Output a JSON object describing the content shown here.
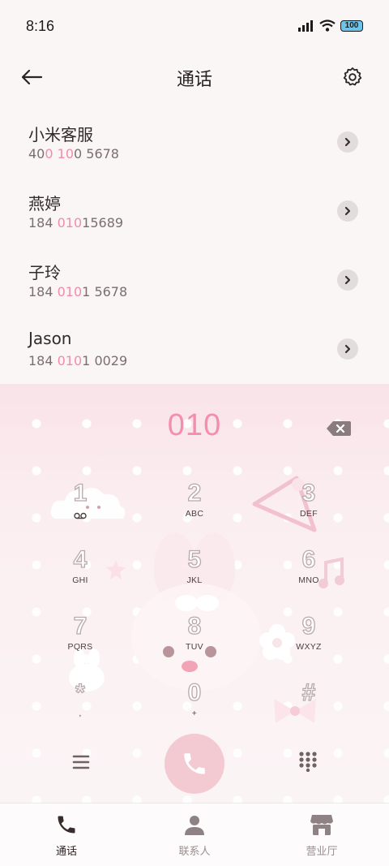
{
  "status_bar": {
    "time": "8:16",
    "battery": "100"
  },
  "header": {
    "title": "通话",
    "back_icon": "arrow-left-icon",
    "settings_icon": "gear-icon"
  },
  "contacts": [
    {
      "name": "小米客服",
      "number_parts": [
        {
          "t": "40",
          "hl": false
        },
        {
          "t": "0",
          "hl": true
        },
        {
          "t": " ",
          "hl": false
        },
        {
          "t": "10",
          "hl": true
        },
        {
          "t": "0 5678",
          "hl": false
        }
      ]
    },
    {
      "name": "燕婷",
      "number_parts": [
        {
          "t": "184 ",
          "hl": false
        },
        {
          "t": "010",
          "hl": true
        },
        {
          "t": "15689",
          "hl": false
        }
      ]
    },
    {
      "name": "子玲",
      "number_parts": [
        {
          "t": "184 ",
          "hl": false
        },
        {
          "t": "010",
          "hl": true
        },
        {
          "t": "1 5678",
          "hl": false
        }
      ]
    },
    {
      "name": "Jason",
      "number_parts": [
        {
          "t": "184 ",
          "hl": false
        },
        {
          "t": "010",
          "hl": true
        },
        {
          "t": "1 0029",
          "hl": false
        }
      ]
    }
  ],
  "dialer": {
    "input": "010",
    "keys": [
      {
        "digit": "1",
        "letters": ""
      },
      {
        "digit": "2",
        "letters": "ABC"
      },
      {
        "digit": "3",
        "letters": "DEF"
      },
      {
        "digit": "4",
        "letters": "GHI"
      },
      {
        "digit": "5",
        "letters": "JKL"
      },
      {
        "digit": "6",
        "letters": "MNO"
      },
      {
        "digit": "7",
        "letters": "PQRS"
      },
      {
        "digit": "8",
        "letters": "TUV"
      },
      {
        "digit": "9",
        "letters": "WXYZ"
      },
      {
        "digit": "*",
        "letters": ","
      },
      {
        "digit": "0",
        "letters": "+"
      },
      {
        "digit": "#",
        "letters": ""
      }
    ]
  },
  "nav": [
    {
      "label": "通话",
      "icon": "phone-icon",
      "active": true
    },
    {
      "label": "联系人",
      "icon": "person-icon",
      "active": false
    },
    {
      "label": "营业厅",
      "icon": "store-icon",
      "active": false
    }
  ],
  "colors": {
    "accent_pink": "#f48db0",
    "call_button": "#f3c9d2"
  }
}
